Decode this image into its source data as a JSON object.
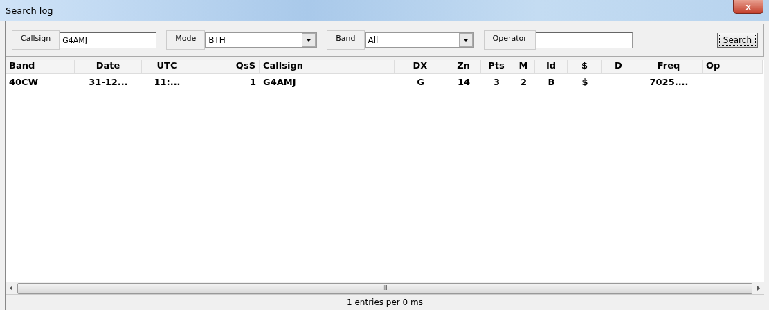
{
  "window": {
    "title": "Search log",
    "close": "x"
  },
  "filters": [
    {
      "label": "Callsign",
      "kind": "text",
      "value": "G4AMJ"
    },
    {
      "label": "Mode",
      "kind": "dropdown",
      "value": "BTH"
    },
    {
      "label": "Band",
      "kind": "dropdown",
      "value": "All"
    },
    {
      "label": "Operator",
      "kind": "text"
    }
  ],
  "search_button": "Search",
  "table": {
    "columns": [
      "Band",
      "Date",
      "UTC",
      "QsS",
      "Callsign",
      "DX",
      "Zn",
      "Pts",
      "M",
      "Id",
      "$",
      "D",
      "Freq",
      "Op"
    ],
    "rows": [
      [
        "40CW",
        "31-12...",
        "11:...",
        "1",
        "G4AMJ",
        "G",
        "14",
        "3",
        "2",
        "B",
        "$",
        null,
        "7025....",
        null
      ]
    ]
  },
  "scrollbar": {
    "grip": "III"
  },
  "status_bar": "1 entries per 0 ms"
}
